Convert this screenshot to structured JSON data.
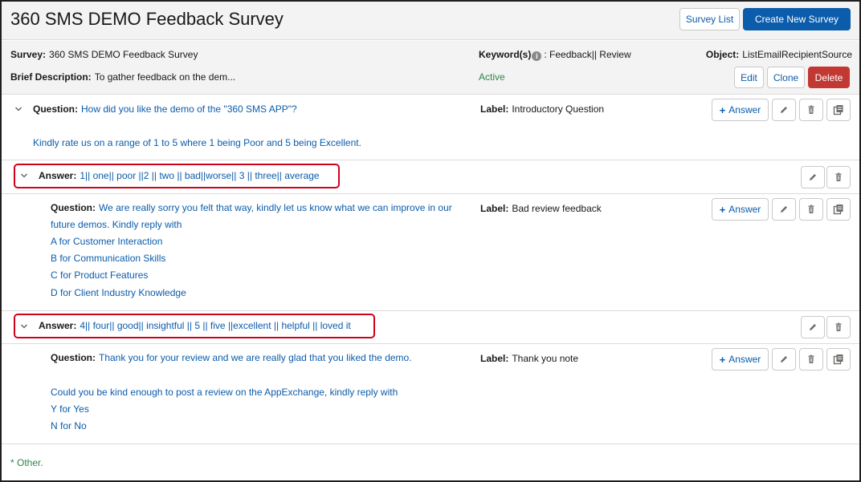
{
  "header": {
    "title": "360 SMS DEMO Feedback Survey",
    "survey_list_label": "Survey List",
    "create_label": "Create New Survey"
  },
  "info": {
    "survey_label": "Survey:",
    "survey_value": "360 SMS DEMO Feedback Survey",
    "keywords_label": "Keyword(s)",
    "keywords_value": ": Feedback|| Review",
    "object_label": "Object:",
    "object_value": "ListEmailRecipientSource",
    "brief_label": "Brief Description:",
    "brief_value": "To gather feedback on the dem...",
    "status": "Active",
    "edit_label": "Edit",
    "clone_label": "Clone",
    "delete_label": "Delete"
  },
  "questions": [
    {
      "question_label": "Question:",
      "lines": [
        "How did you like the demo of the \"360 SMS APP\"?",
        "Kindly rate us on a range of 1 to 5 where 1 being Poor and 5 being Excellent."
      ],
      "label_caption": "Label:",
      "label_value": "Introductory Question"
    },
    {
      "question_label": "Question:",
      "lines": [
        "We are really sorry you felt that way, kindly let us know what we can improve in our",
        "future demos. Kindly reply with",
        "A for Customer Interaction",
        "B for Communication Skills",
        "C for Product Features",
        "D for Client Industry Knowledge"
      ],
      "label_caption": "Label:",
      "label_value": "Bad review feedback"
    },
    {
      "question_label": "Question:",
      "lines": [
        "Thank you for your review and we are really glad that you liked the demo.",
        "Could you be kind enough to post a review on the AppExchange, kindly reply with",
        "Y for Yes",
        "N for No"
      ],
      "label_caption": "Label:",
      "label_value": "Thank you note"
    }
  ],
  "answers": [
    {
      "label": "Answer:",
      "value": "1|| one|| poor ||2 || two || bad||worse|| 3 || three|| average"
    },
    {
      "label": "Answer:",
      "value": "4|| four|| good|| insightful || 5 || five ||excellent || helpful || loved it"
    }
  ],
  "answer_button_label": "Answer",
  "footer": {
    "other": "* Other."
  },
  "colors": {
    "brand": "#0b5cab",
    "danger": "#c23934",
    "active": "#2e844a",
    "highlight": "#d0021b"
  },
  "icons": [
    "chevron-down-icon",
    "info-icon",
    "plus-icon",
    "pencil-icon",
    "trash-icon",
    "copy-icon"
  ]
}
